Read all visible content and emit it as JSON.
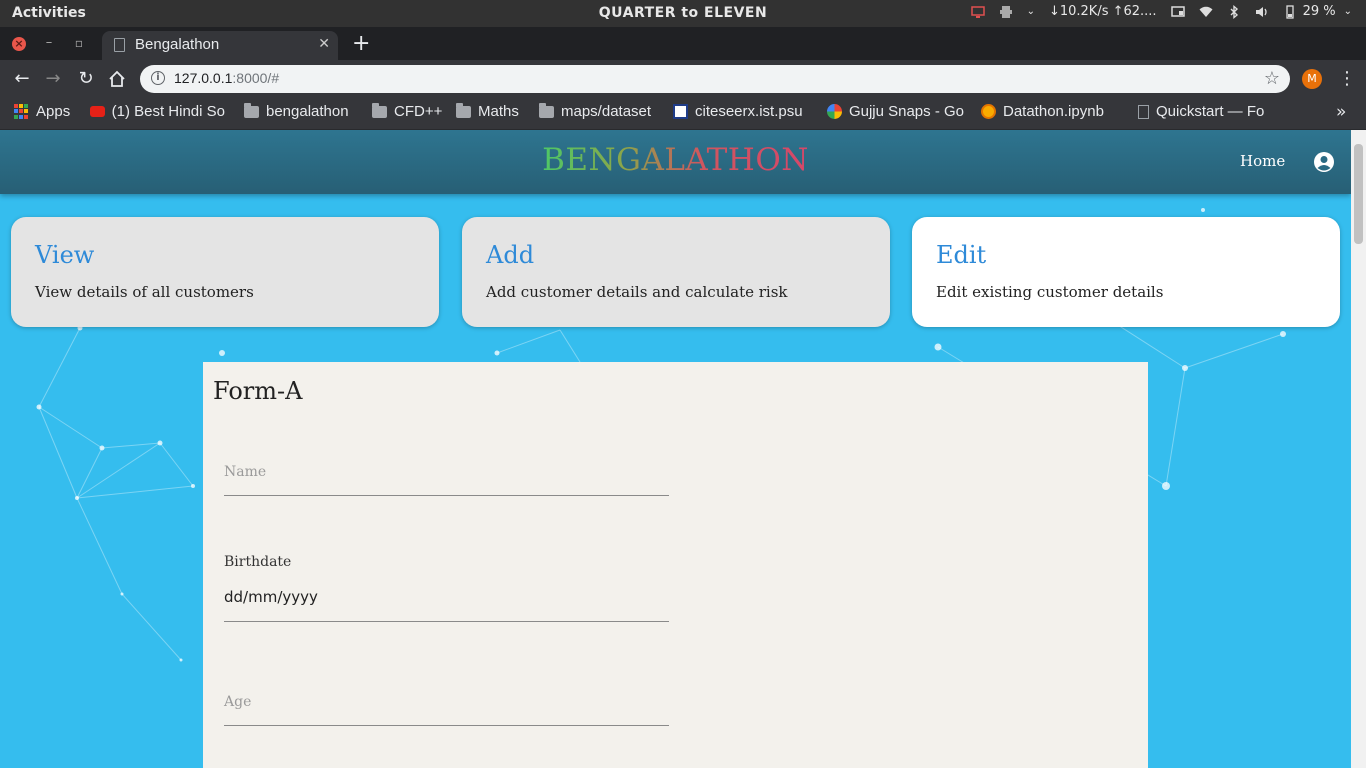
{
  "os": {
    "activities": "Activities",
    "clock": "QUARTER to ELEVEN",
    "net_speed": "↓10.2K/s ↑62....",
    "battery": "29 %"
  },
  "browser": {
    "tab_title": "Bengalathon",
    "url_host": "127.0.0.1",
    "url_rest": ":8000/#",
    "profile_initial": "M",
    "bookmarks": [
      {
        "label": "Apps",
        "icon": "apps-grid-icon"
      },
      {
        "label": "(1) Best Hindi So",
        "icon": "youtube-icon"
      },
      {
        "label": "bengalathon",
        "icon": "folder-icon"
      },
      {
        "label": "CFD++",
        "icon": "folder-icon"
      },
      {
        "label": "Maths",
        "icon": "folder-icon"
      },
      {
        "label": "maps/dataset",
        "icon": "folder-icon"
      },
      {
        "label": "citeseerx.ist.psu",
        "icon": "citeseerx-icon"
      },
      {
        "label": "Gujju Snaps - Go",
        "icon": "pinwheel-icon"
      },
      {
        "label": "Datathon.ipynb",
        "icon": "colab-icon"
      },
      {
        "label": "Quickstart — Fo",
        "icon": "page-icon"
      }
    ]
  },
  "app": {
    "brand": "BENGALATHON",
    "nav_home": "Home",
    "cards": [
      {
        "title": "View",
        "desc": "View details of all customers",
        "active": false
      },
      {
        "title": "Add",
        "desc": "Add customer details and calculate risk",
        "active": false
      },
      {
        "title": "Edit",
        "desc": "Edit existing customer details",
        "active": true
      }
    ],
    "form": {
      "title": "Form-A",
      "name_placeholder": "Name",
      "birthdate_label": "Birthdate",
      "birthdate_value": "dd/mm/yyyy",
      "age_placeholder": "Age"
    }
  },
  "colors": {
    "page_bg": "#35bdee",
    "appbar": "#2e7590",
    "card_title": "#2e8ad8"
  }
}
